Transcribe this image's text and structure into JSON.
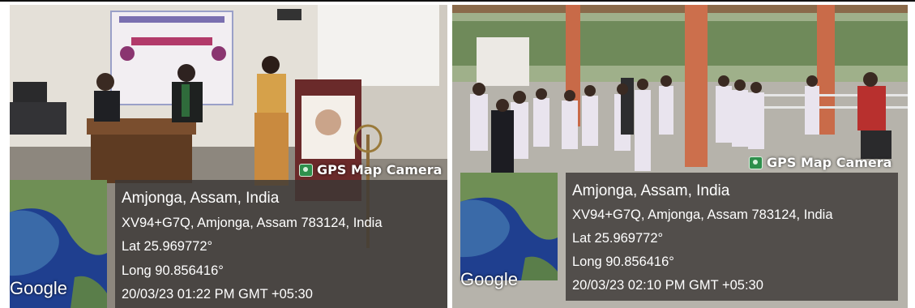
{
  "photos": [
    {
      "stamp": "GPS Map Camera",
      "map_label": "Google",
      "place": "Amjonga, Assam, India",
      "address": "XV94+G7Q, Amjonga, Assam 783124, India",
      "lat": "Lat 25.969772°",
      "long": "Long 90.856416°",
      "datetime": "20/03/23 01:22 PM GMT +05:30"
    },
    {
      "stamp": "GPS Map Camera",
      "map_label": "Google",
      "place": "Amjonga, Assam, India",
      "address": "XV94+G7Q, Amjonga, Assam 783124, India",
      "lat": "Lat 25.969772°",
      "long": "Long 90.856416°",
      "datetime": "20/03/23 02:10 PM GMT +05:30"
    }
  ],
  "colors": {
    "overlay_bg": "#3c3836",
    "map_sea": "#1f3f8f",
    "map_land": "#6f8f55",
    "camera_icon": "#2e8f4c"
  }
}
